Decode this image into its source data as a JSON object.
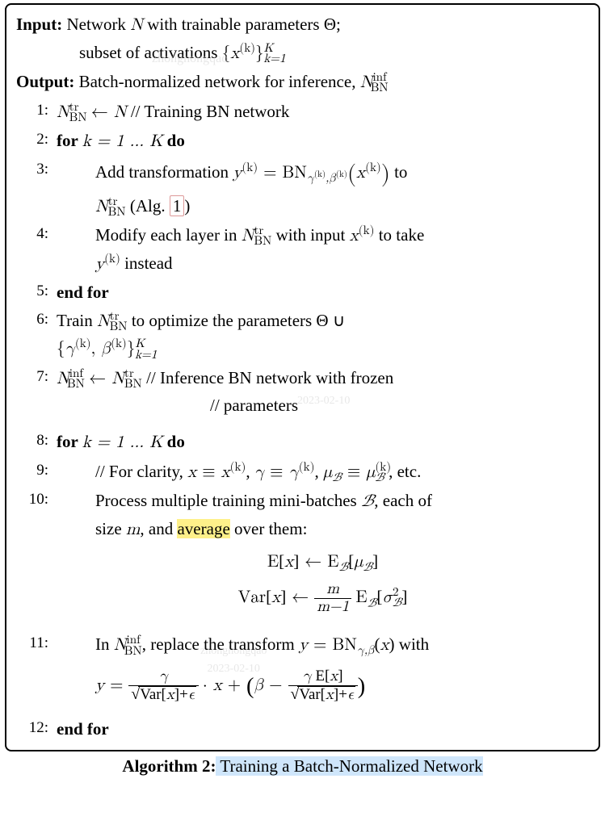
{
  "input": {
    "label": "Input:",
    "line1_a": "Network ",
    "line1_b": " with trainable parameters Θ;",
    "N": "N",
    "line2": "subset of activations ",
    "set_open": "{",
    "x": "x",
    "sup_k": "(k)",
    "set_close": "}",
    "sub_k1": "k=1",
    "sup_K": "K"
  },
  "output": {
    "label": "Output:",
    "text": "Batch-normalized network for inference, ",
    "N": "N",
    "sup": "inf",
    "sub": "BN"
  },
  "steps": {
    "s1": {
      "N1": "N",
      "sup1": "tr",
      "sub1": "BN",
      "arrow": " ← ",
      "N2": "N",
      "comment": "    // Training BN network"
    },
    "s2": {
      "for": "for ",
      "cond": "k = 1 … K",
      "do": " do"
    },
    "s3": {
      "a": "Add  transformation  ",
      "y": "y",
      "eq": "  =  ",
      "BN": "BN",
      "g": "γ",
      "b": "β",
      "x": "x",
      "to": "  to",
      "l2a": "N",
      "l2sup": "tr",
      "l2sub": "BN",
      "l2b": " (Alg. ",
      "ref": "1",
      "l2c": ")"
    },
    "s4": {
      "a": "Modify each layer in ",
      "N": "N",
      "sup": "tr",
      "sub": "BN",
      "b": " with input ",
      "x": "x",
      "c": " to take",
      "l2a": "y",
      "l2b": " instead"
    },
    "s5": {
      "text": "end for"
    },
    "s6": {
      "a": "Train   ",
      "N": "N",
      "sup": "tr",
      "sub": "BN",
      "b": "    to   optimize    the    parameters    Θ   ∪",
      "l2_open": "{",
      "g": "γ",
      "comma": ", ",
      "bparam": "β",
      "l2_close": "}",
      "subk1": "k=1",
      "supK": "K"
    },
    "s7": {
      "N1": "N",
      "sup1": "inf",
      "sub1": "BN",
      "arrow": " ← ",
      "N2": "N",
      "sup2": "tr",
      "sub2": "BN",
      "c1": "    // Inference BN network with frozen",
      "c2": "// parameters"
    },
    "s8": {
      "for": "for ",
      "cond": "k = 1 … K",
      "do": " do"
    },
    "s9": {
      "a": "// For clarity, ",
      "x": "x",
      "eqv": " ≡ ",
      "g": "γ",
      "mu": "μ",
      "B": "ℬ",
      "etc": " , etc."
    },
    "s10": {
      "a": "Process  multiple  training  mini-batches  ",
      "B": "ℬ",
      "b": ",  each  of",
      "l2a": "size ",
      "m": "m",
      "l2b": ", and ",
      "avg": "average",
      "l2c": " over them:",
      "E": "E",
      "x": "x",
      "arrow": " ← ",
      "mu": "μ",
      "Var": "Var",
      "frac_num": "m",
      "frac_den": "m−1",
      "sigma": "σ",
      "sq": "2"
    },
    "s11": {
      "a": "In ",
      "N": "N",
      "sup": "inf",
      "sub": "BN",
      "b": ", replace the transform ",
      "y": "y",
      "eq": " = ",
      "BN": "BN",
      "g": "γ",
      "bp": "β",
      "x": "x",
      "c": " with",
      "Var": "Var",
      "E": "E",
      "eps": "ϵ",
      "dot": " · ",
      "plus": " + ",
      "minus": " − "
    },
    "s12": {
      "text": "end for"
    }
  },
  "caption": {
    "strong": "Algorithm 2:",
    "rest": " Training a Batch-Normalized Network"
  }
}
